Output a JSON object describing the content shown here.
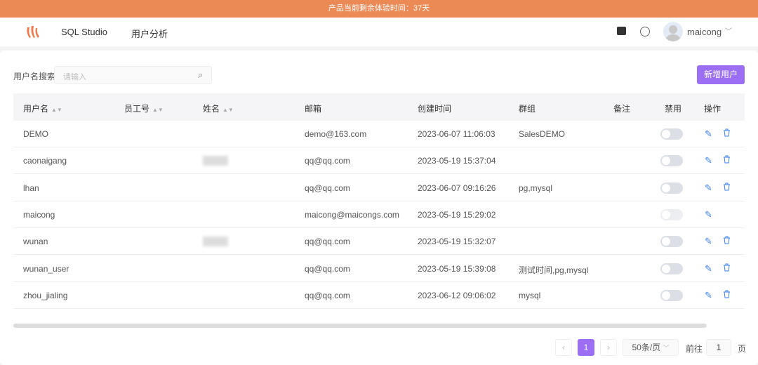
{
  "banner": "产品当前剩余体验时间：37天",
  "nav": {
    "items": [
      "SQL Studio",
      "用户分析"
    ],
    "user": "maicong"
  },
  "search": {
    "label": "用户名搜索",
    "placeholder": "请输入"
  },
  "add_button": "新增用户",
  "columns": [
    "用户名",
    "员工号",
    "姓名",
    "邮箱",
    "创建时间",
    "群组",
    "备注",
    "禁用",
    "操作"
  ],
  "rows": [
    {
      "username": "DEMO",
      "email": "demo@163.com",
      "created": "2023-06-07 11:06:03",
      "group": "SalesDEMO",
      "name_blurred": false,
      "deletable": true,
      "toggle_disabled": false
    },
    {
      "username": "caonaigang",
      "email": "qq@qq.com",
      "created": "2023-05-19 15:37:04",
      "group": "",
      "name_blurred": true,
      "deletable": true,
      "toggle_disabled": false
    },
    {
      "username": "lhan",
      "email": "qq@qq.com",
      "created": "2023-06-07 09:16:26",
      "group": "pg,mysql",
      "name_blurred": false,
      "deletable": true,
      "toggle_disabled": false
    },
    {
      "username": "maicong",
      "email": "maicong@maicongs.com",
      "created": "2023-05-19 15:29:02",
      "group": "",
      "name_blurred": false,
      "deletable": false,
      "toggle_disabled": true
    },
    {
      "username": "wunan",
      "email": "qq@qq.com",
      "created": "2023-05-19 15:32:07",
      "group": "",
      "name_blurred": true,
      "deletable": true,
      "toggle_disabled": false
    },
    {
      "username": "wunan_user",
      "email": "qq@qq.com",
      "created": "2023-05-19 15:39:08",
      "group": "测试时间,pg,mysql",
      "name_blurred": false,
      "deletable": true,
      "toggle_disabled": false
    },
    {
      "username": "zhou_jialing",
      "email": "qq@qq.com",
      "created": "2023-06-12 09:06:02",
      "group": "mysql",
      "name_blurred": false,
      "deletable": true,
      "toggle_disabled": false
    }
  ],
  "pagination": {
    "current": "1",
    "page_size": "50条/页",
    "goto_label": "前往",
    "goto_value": "1",
    "page_suffix": "页"
  },
  "colors": {
    "accent": "#9b6ef3",
    "banner": "#ec8a56",
    "link": "#3a7ff0"
  }
}
